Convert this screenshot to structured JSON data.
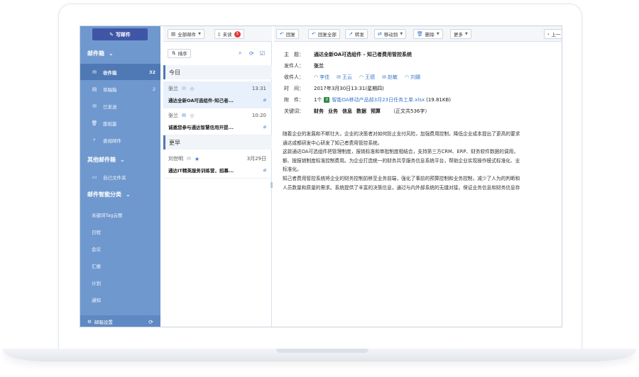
{
  "sidebar": {
    "compose_label": "写邮件",
    "mailbox_title": "邮件箱",
    "items": [
      {
        "label": "收件箱",
        "count": "32",
        "icon": "inbox-icon"
      },
      {
        "label": "草稿箱",
        "count": "2",
        "icon": "draft-icon"
      },
      {
        "label": "已发送",
        "count": "",
        "icon": "sent-icon"
      },
      {
        "label": "废纸篓",
        "count": "",
        "icon": "trash-icon"
      },
      {
        "label": "查阅邮件",
        "count": "",
        "icon": "review-icon"
      }
    ],
    "other_title": "其他邮件箱",
    "other_items": [
      {
        "label": "自己文件夹",
        "icon": "folder-icon"
      }
    ],
    "smart_title": "邮件智能分类",
    "smart_items": [
      "关键词Tag云图",
      "日程",
      "会议",
      "汇报",
      "计划",
      "通知"
    ],
    "footer_label": "邮箱设置"
  },
  "list": {
    "filter_all": "全部邮件",
    "filter_unread": "未读",
    "unread_badge": "3",
    "sort_label": "排序",
    "groups": [
      {
        "title": "今日"
      },
      {
        "title": "更早"
      }
    ],
    "mails": [
      {
        "sender": "张兰",
        "time": "13:31",
        "subject": "通达全新OA可选组件-知己者..."
      },
      {
        "sender": "张兰",
        "time": "10:20",
        "subject": "诚邀您参与通达智慧信用开提..."
      },
      {
        "sender": "刘世明",
        "time": "3月29日",
        "subject": "通达IT精英服务训练营，招募..."
      }
    ]
  },
  "toolbar": {
    "reply": "回复",
    "reply_all": "回复全部",
    "forward": "转发",
    "move_to": "移动到",
    "delete": "删除",
    "more": "更多",
    "prev": "上一"
  },
  "message": {
    "subject_label": "主　题：",
    "subject": "通达全新OA可选组件 - 知己者费用管控系统",
    "from_label": "发件人：",
    "from": "张兰",
    "to_label": "收件人：",
    "recipients": [
      "李佳",
      "王云",
      "王德",
      "赵敏",
      "刘娜"
    ],
    "time_label": "时　间：",
    "time": "2017年3月30日13:31(星期四)",
    "attach_label": "附　件：",
    "attach_count": "1个",
    "attach_name": "智能OA移动产品部3月23日任务工单.xlsx",
    "attach_size": "(19.81KB)",
    "keywords_label": "关键词：",
    "keywords": [
      "财务",
      "业务",
      "信息",
      "数据",
      "预算"
    ],
    "word_count": "（正文共536字）",
    "body": [
      "随着企业的发展和不断壮大，企业的决策者对如何防止支付风险，加强费用控制，降低企业成本提出了更高的要求",
      "通达成都研发中心研发了知己者费用管控系统。",
      "这款通达OA可选组件把管理制度，报销标准和审批制度相结合，支持第三方CRM、ERP、财务软件数据的调用，",
      "额、按报销制度标准控制费用。为企业打造统一的财务共享服务信息系统平台，帮助企业实现操作模式标准化、业",
      "标准化。",
      "知己者费用管控系统将企业的财务控制前移至业务前端，强化了事前的预算控制和业务控制，减少了人为的判断和",
      "人员数量和质量的需求。系统提供了丰富的决策信息，通过与内外部系统的无缝对接，保证业务信息和财务信息存"
    ]
  }
}
